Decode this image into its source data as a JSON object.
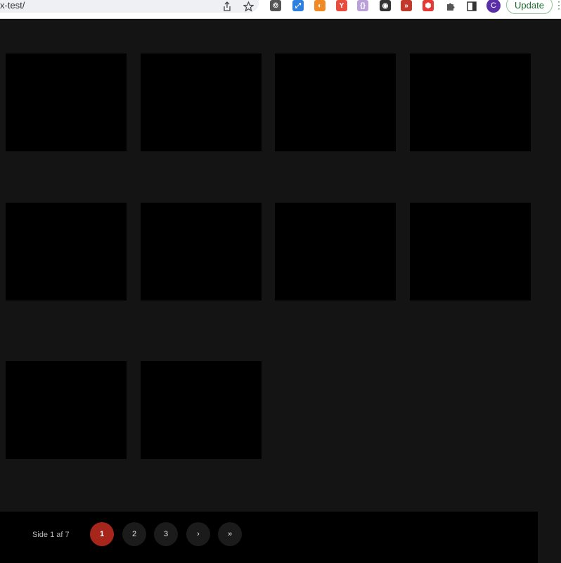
{
  "browser": {
    "url": "x-test/",
    "avatar_initial": "C",
    "update_label": "Update",
    "extensions": [
      {
        "name": "recycle-icon",
        "glyph": "♲",
        "color": "#555555"
      },
      {
        "name": "resize-extension-icon",
        "glyph": "⤢",
        "color": "#2f7fe0"
      },
      {
        "name": "moon-extension-icon",
        "glyph": "◐",
        "color": "#f08a24"
      },
      {
        "name": "y-extension-icon",
        "glyph": "Y",
        "color": "#e74c3c"
      },
      {
        "name": "json-extension-icon",
        "glyph": "{}",
        "color": "#b9a0d8"
      },
      {
        "name": "eye-extension-icon",
        "glyph": "◉",
        "color": "#333333"
      },
      {
        "name": "forward-extension-icon",
        "glyph": "»",
        "color": "#c0392b"
      },
      {
        "name": "shield-extension-icon",
        "glyph": "⬢",
        "color": "#e53935"
      }
    ]
  },
  "pagination": {
    "label": "Side 1 af 7",
    "pages": [
      "1",
      "2",
      "3"
    ],
    "next": "›",
    "last": "»",
    "active_color": "#a6261c"
  }
}
